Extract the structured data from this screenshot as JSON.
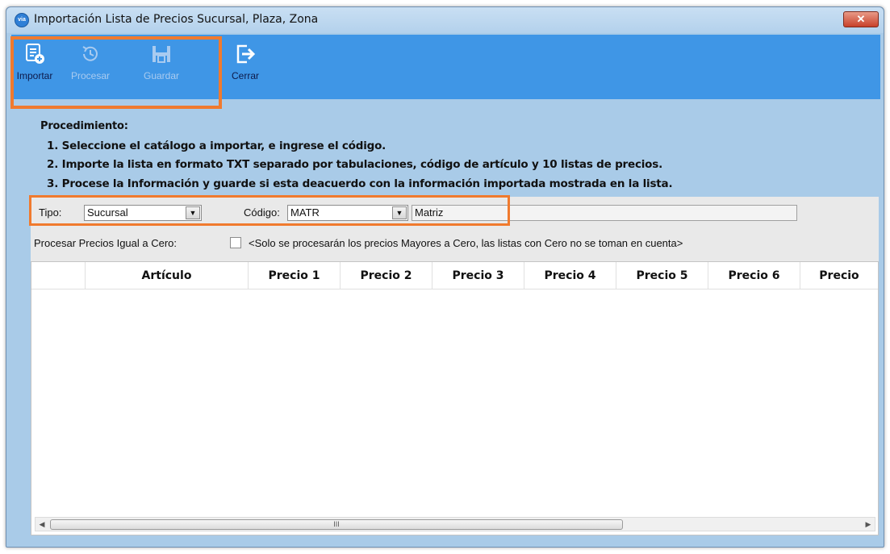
{
  "window": {
    "icon_text": "via",
    "title": "Importación Lista de Precios Sucursal, Plaza, Zona",
    "close_label": "✕"
  },
  "toolbar": {
    "import_label": "Importar",
    "process_label": "Procesar",
    "save_label": "Guardar",
    "close_label": "Cerrar"
  },
  "procedure": {
    "title": "Procedimiento:",
    "steps": [
      "1. Seleccione el catálogo a importar, e ingrese el código.",
      "2. Importe la lista en formato TXT separado por tabulaciones, código de artículo y 10 listas de precios.",
      "3. Procese la Información y guarde si esta deacuerdo con la información importada mostrada en la lista."
    ]
  },
  "filter": {
    "tipo_label": "Tipo:",
    "tipo_value": "Sucursal",
    "codigo_label": "Código:",
    "codigo_value": "MATR",
    "codigo_name": "Matriz"
  },
  "zero_prices": {
    "label": "Procesar Precios Igual a Cero:",
    "checked": false,
    "note": "<Solo se procesarán los precios Mayores a Cero, las listas con Cero no se toman en cuenta>"
  },
  "grid": {
    "columns": [
      "",
      "Artículo",
      "Precio 1",
      "Precio 2",
      "Precio 3",
      "Precio 4",
      "Precio 5",
      "Precio 6",
      "Precio"
    ],
    "scroll_grip": "III"
  },
  "colors": {
    "toolbar": "#3f96e6",
    "window_bg": "#a9cbe8",
    "highlight": "#f07a2e"
  }
}
